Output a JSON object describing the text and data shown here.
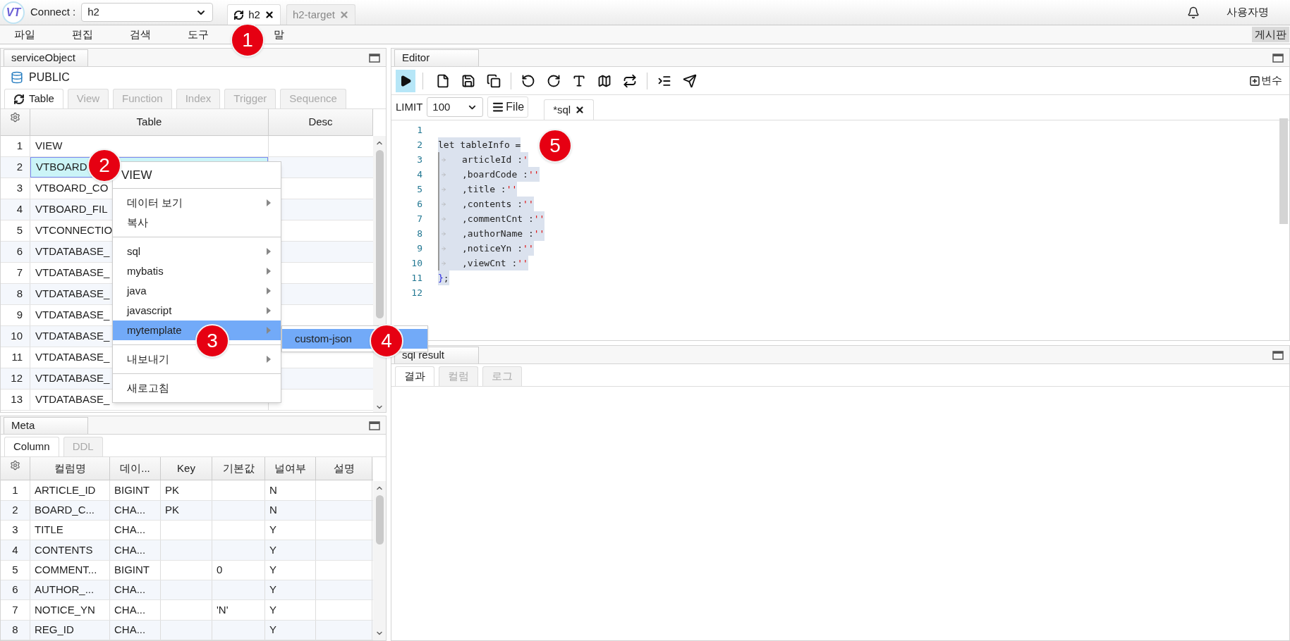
{
  "top_bar": {
    "logo": "VT",
    "connect_label": "Connect :",
    "connection": "h2",
    "tabs": [
      {
        "label": "h2",
        "selected": true,
        "refresh": true
      },
      {
        "label": "h2-target",
        "selected": false,
        "refresh": false
      }
    ],
    "user": "사용자명"
  },
  "menu": [
    "파일",
    "편집",
    "검색",
    "도구",
    "말"
  ],
  "board_button": "게시판",
  "object_panel": {
    "title": "serviceObject",
    "schema": "PUBLIC",
    "tabs": [
      {
        "label": "Table",
        "selected": true
      },
      {
        "label": "View",
        "selected": false
      },
      {
        "label": "Function",
        "selected": false
      },
      {
        "label": "Index",
        "selected": false
      },
      {
        "label": "Trigger",
        "selected": false
      },
      {
        "label": "Sequence",
        "selected": false
      }
    ],
    "columns": [
      "",
      "Table",
      "Desc"
    ],
    "rows": [
      {
        "number": "1",
        "table": "VIEW",
        "selected": false
      },
      {
        "number": "2",
        "table": "VTBOARD",
        "selected": true
      },
      {
        "number": "3",
        "table": "VTBOARD_CO",
        "selected": false
      },
      {
        "number": "4",
        "table": "VTBOARD_FIL",
        "selected": false
      },
      {
        "number": "5",
        "table": "VTCONNECTIO",
        "selected": false
      },
      {
        "number": "6",
        "table": "VTDATABASE_",
        "selected": false
      },
      {
        "number": "7",
        "table": "VTDATABASE_",
        "selected": false
      },
      {
        "number": "8",
        "table": "VTDATABASE_",
        "selected": false
      },
      {
        "number": "9",
        "table": "VTDATABASE_",
        "selected": false
      },
      {
        "number": "10",
        "table": "VTDATABASE_",
        "selected": false
      },
      {
        "number": "11",
        "table": "VTDATABASE_",
        "selected": false
      },
      {
        "number": "12",
        "table": "VTDATABASE_",
        "selected": false
      },
      {
        "number": "13",
        "table": "VTDATABASE_",
        "selected": false
      }
    ]
  },
  "context_menu": {
    "title": "VIEW",
    "groups": [
      [
        {
          "label": "데이터 보기",
          "submenu": true,
          "selected": false
        },
        {
          "label": "복사",
          "submenu": false,
          "selected": false
        }
      ],
      [
        {
          "label": "sql",
          "submenu": true,
          "selected": false
        },
        {
          "label": "mybatis",
          "submenu": true,
          "selected": false
        },
        {
          "label": "java",
          "submenu": true,
          "selected": false
        },
        {
          "label": "javascript",
          "submenu": true,
          "selected": false
        },
        {
          "label": "mytemplate",
          "submenu": true,
          "selected": true
        }
      ],
      [
        {
          "label": "내보내기",
          "submenu": true,
          "selected": false
        }
      ],
      [
        {
          "label": "새로고침",
          "submenu": false,
          "selected": false
        }
      ]
    ],
    "submenu": [
      {
        "label": "custom-json",
        "selected": true
      }
    ]
  },
  "meta_panel": {
    "title": "Meta",
    "tabs": [
      {
        "label": "Column",
        "selected": true
      },
      {
        "label": "DDL",
        "selected": false
      }
    ],
    "columns": [
      "",
      "컬럼명",
      "데이...",
      "Key",
      "기본값",
      "널여부",
      "설명"
    ],
    "rows": [
      [
        "1",
        "ARTICLE_ID",
        "BIGINT",
        "PK",
        "",
        "N",
        ""
      ],
      [
        "2",
        "BOARD_C...",
        "CHA...",
        "PK",
        "",
        "N",
        ""
      ],
      [
        "3",
        "TITLE",
        "CHA...",
        "",
        "",
        "Y",
        ""
      ],
      [
        "4",
        "CONTENTS",
        "CHA...",
        "",
        "",
        "Y",
        ""
      ],
      [
        "5",
        "COMMENT...",
        "BIGINT",
        "",
        "0",
        "Y",
        ""
      ],
      [
        "6",
        "AUTHOR_...",
        "CHA...",
        "",
        "",
        "Y",
        ""
      ],
      [
        "7",
        "NOTICE_YN",
        "CHA...",
        "",
        "'N'",
        "Y",
        ""
      ],
      [
        "8",
        "REG_ID",
        "CHA...",
        "",
        "",
        "Y",
        ""
      ]
    ]
  },
  "editor": {
    "title": "Editor",
    "run_active": true,
    "variables_button": "변수",
    "limit_label": "LIMIT",
    "limit": "100",
    "file_button": "File",
    "tabs": [
      {
        "label": "*sql",
        "selected": true
      }
    ],
    "lines": [
      {
        "number": "1",
        "selected": false,
        "indent": false
      },
      {
        "number": "2",
        "selected": true,
        "indent": false,
        "segments": [
          {
            "kind": "plain",
            "text": "let tableInfo ="
          }
        ]
      },
      {
        "number": "3",
        "selected": true,
        "indent": true,
        "segments": [
          {
            "kind": "plain",
            "text": "articleId :"
          },
          {
            "kind": "string",
            "text": "'"
          }
        ]
      },
      {
        "number": "4",
        "selected": true,
        "indent": true,
        "segments": [
          {
            "kind": "plain",
            "text": ",boardCode :"
          },
          {
            "kind": "string",
            "text": "''"
          }
        ]
      },
      {
        "number": "5",
        "selected": true,
        "indent": true,
        "segments": [
          {
            "kind": "plain",
            "text": ",title :"
          },
          {
            "kind": "string",
            "text": "''"
          }
        ]
      },
      {
        "number": "6",
        "selected": true,
        "indent": true,
        "segments": [
          {
            "kind": "plain",
            "text": ",contents :"
          },
          {
            "kind": "string",
            "text": "''"
          }
        ]
      },
      {
        "number": "7",
        "selected": true,
        "indent": true,
        "segments": [
          {
            "kind": "plain",
            "text": ",commentCnt :"
          },
          {
            "kind": "string",
            "text": "''"
          }
        ]
      },
      {
        "number": "8",
        "selected": true,
        "indent": true,
        "segments": [
          {
            "kind": "plain",
            "text": ",authorName :"
          },
          {
            "kind": "string",
            "text": "''"
          }
        ]
      },
      {
        "number": "9",
        "selected": true,
        "indent": true,
        "segments": [
          {
            "kind": "plain",
            "text": ",noticeYn :"
          },
          {
            "kind": "string",
            "text": "''"
          }
        ]
      },
      {
        "number": "10",
        "selected": true,
        "indent": true,
        "segments": [
          {
            "kind": "plain",
            "text": ",viewCnt :"
          },
          {
            "kind": "string",
            "text": "''"
          }
        ]
      },
      {
        "number": "11",
        "selected": true,
        "indent": false,
        "segments": [
          {
            "kind": "bracket",
            "text": "}"
          },
          {
            "kind": "plain",
            "text": ";"
          }
        ]
      },
      {
        "number": "12",
        "selected": false,
        "indent": false
      }
    ]
  },
  "result_panel": {
    "title": "sql result",
    "tabs": [
      {
        "label": "결과",
        "selected": true
      },
      {
        "label": "컬럼",
        "selected": false
      },
      {
        "label": "로그",
        "selected": false
      }
    ]
  },
  "annotations": [
    {
      "label": "1"
    },
    {
      "label": "2"
    },
    {
      "label": "3"
    },
    {
      "label": "4"
    },
    {
      "label": "5"
    }
  ]
}
